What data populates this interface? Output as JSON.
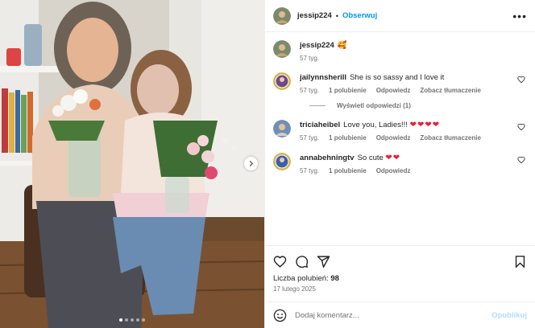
{
  "post": {
    "username": "jessip224",
    "follow_label": "Obserwuj",
    "separator": "•",
    "more_label": "•••",
    "photo_dots": 5,
    "active_dot": 0
  },
  "caption": {
    "username": "jessip224",
    "text": "🥰",
    "time": "57 tyg."
  },
  "comments": [
    {
      "username": "jailynnsherill",
      "text": "She is so sassy and I love it",
      "time": "57 tyg.",
      "likes": "1 polubienie",
      "reply": "Odpowiedz",
      "translate": "Zobacz tłumaczenie",
      "avatar_color": "#d9b24a"
    },
    {
      "username": "triciaheibel",
      "text": "Love you, Ladies!!!",
      "hearts": "❤❤❤❤",
      "time": "57 tyg.",
      "likes": "1 polubienie",
      "reply": "Odpowiedz",
      "translate": "Zobacz tłumaczenie",
      "avatar_color": "#6f8fb8"
    },
    {
      "username": "annabehningtv",
      "text": "So cute",
      "hearts": "❤❤",
      "time": "57 tyg.",
      "likes": "1 polubienie",
      "reply": "Odpowiedz",
      "avatar_color": "#3a5fb0"
    }
  ],
  "view_replies": "Wyświetl odpowiedzi (1)",
  "likes_label": "Liczba polubień:",
  "likes_count": "98",
  "date": "17 lutego 2025",
  "composer": {
    "placeholder": "Dodaj komentarz...",
    "post_label": "Opublikuj"
  },
  "colors": {
    "accent": "#0095f6",
    "heart": "#ed1c3a",
    "muted": "#737373"
  },
  "icons": [
    "heart-icon",
    "comment-icon",
    "share-icon",
    "bookmark-icon",
    "emoji-icon",
    "chevron-right-icon",
    "more-icon"
  ]
}
